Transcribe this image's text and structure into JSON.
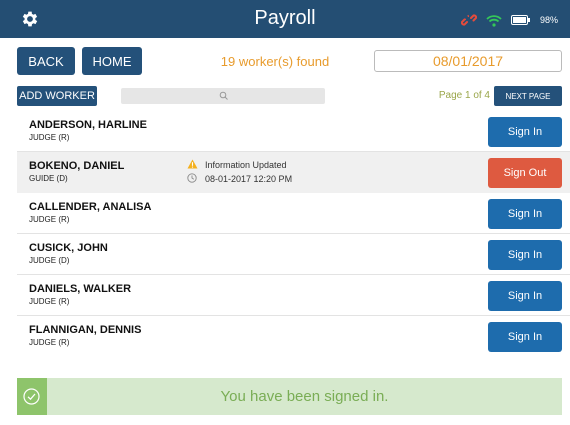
{
  "header": {
    "title": "Payroll",
    "battery_pct": "98%",
    "icons": [
      "gear-icon",
      "broken-link-icon",
      "wifi-icon",
      "battery-icon"
    ],
    "colors": {
      "bar": "#244e73",
      "link": "#e64b3c",
      "wifi": "#34c759"
    }
  },
  "toolbar": {
    "back_label": "BACK",
    "home_label": "HOME",
    "workers_found": "19 worker(s) found",
    "date": "08/01/2017",
    "add_worker_label": "ADD WORKER",
    "page_indicator": "Page 1 of 4",
    "next_page_label": "NEXT PAGE"
  },
  "workers": [
    {
      "name": "ANDERSON, HARLINE",
      "role": "JUDGE (R)",
      "action": "Sign In"
    },
    {
      "name": "BOKENO, DANIEL",
      "role": "GUIDE (D)",
      "action": "Sign Out",
      "info": "Information Updated",
      "info_time": "08-01-2017 12:20 PM"
    },
    {
      "name": "CALLENDER, ANALISA",
      "role": "JUDGE (R)",
      "action": "Sign In"
    },
    {
      "name": "CUSICK, JOHN",
      "role": "JUDGE (D)",
      "action": "Sign In"
    },
    {
      "name": "DANIELS, WALKER",
      "role": "JUDGE (R)",
      "action": "Sign In"
    },
    {
      "name": "FLANNIGAN, DENNIS",
      "role": "JUDGE (R)",
      "action": "Sign In"
    }
  ],
  "toast": {
    "message": "You have been signed in."
  },
  "colors": {
    "primary": "#24517a",
    "sign_in": "#1e6cad",
    "sign_out": "#de5a40",
    "accent_orange": "#e89b2c",
    "success": "#8ec46b"
  }
}
